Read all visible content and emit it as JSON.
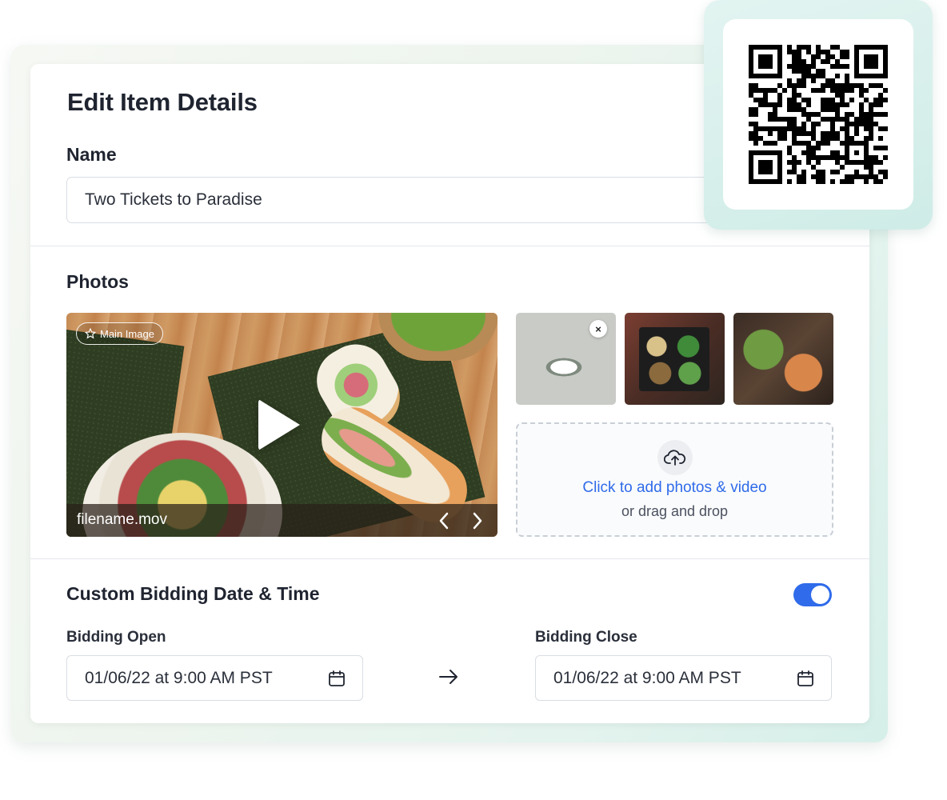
{
  "form": {
    "title": "Edit Item Details",
    "name_label": "Name",
    "name_value": "Two Tickets to Paradise",
    "photos_label": "Photos"
  },
  "media": {
    "main_badge": "Main Image",
    "filename": "filename.mov",
    "dropzone_primary": "Click to add photos & video",
    "dropzone_secondary": "or drag and drop",
    "remove_label": "×"
  },
  "bidding": {
    "section_title": "Custom Bidding Date & Time",
    "toggle_on": true,
    "open_label": "Bidding Open",
    "open_value": "01/06/22 at 9:00 AM PST",
    "close_label": "Bidding Close",
    "close_value": "01/06/22 at 9:00 AM PST"
  },
  "icons": [
    "star-icon",
    "play-icon",
    "chevron-left-icon",
    "chevron-right-icon",
    "close-icon",
    "cloud-upload-icon",
    "calendar-icon",
    "arrow-right-icon",
    "qr-code"
  ],
  "colors": {
    "accent": "#2f6bea",
    "qr_frame": "#d6efe9"
  }
}
